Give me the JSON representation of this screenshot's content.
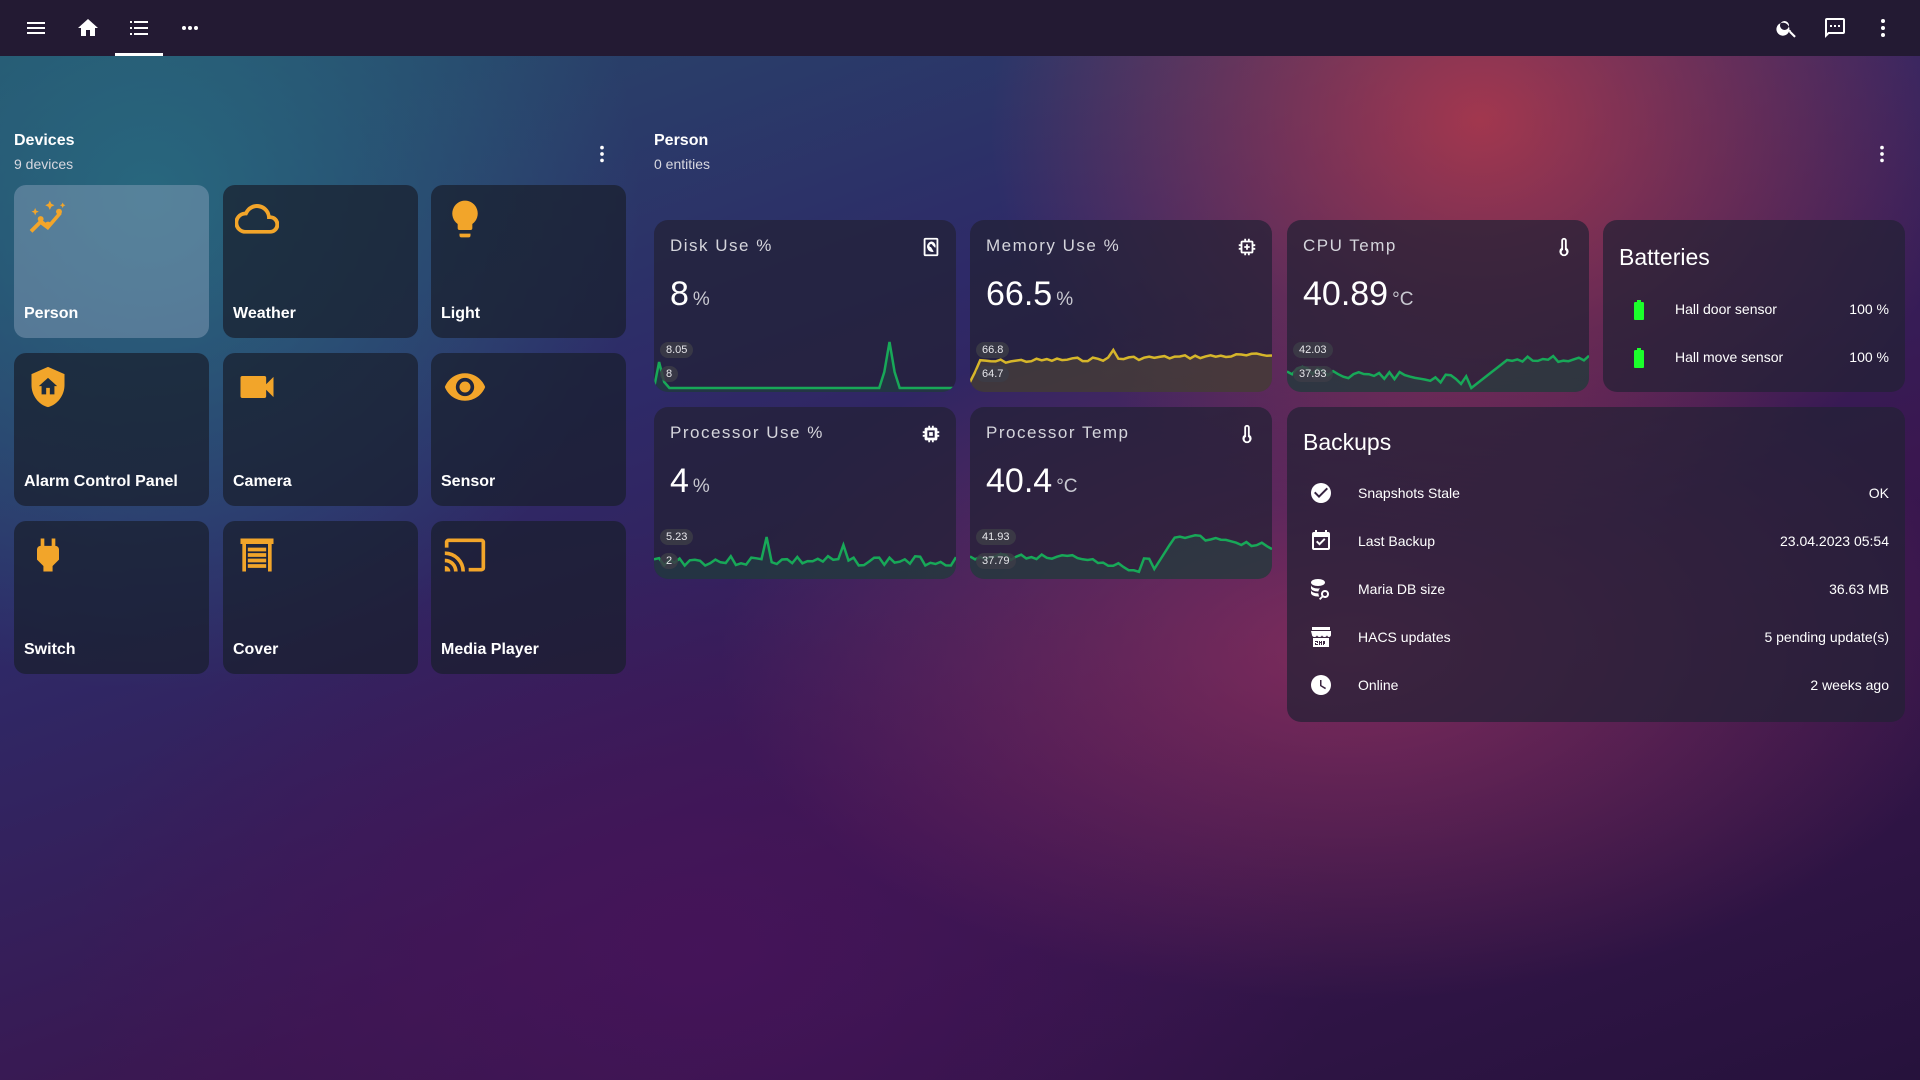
{
  "topbar": {
    "icons": [
      "menu-icon",
      "home-icon",
      "list-icon",
      "more-horizontal-icon",
      "search-icon",
      "assist-chat-icon",
      "more-vertical-icon"
    ]
  },
  "devices": {
    "title": "Devices",
    "subtitle": "9 devices",
    "tiles": [
      {
        "label": "Person",
        "icon": "person-motion-icon"
      },
      {
        "label": "Weather",
        "icon": "cloud-icon"
      },
      {
        "label": "Light",
        "icon": "lightbulb-icon"
      },
      {
        "label": "Alarm Control Panel",
        "icon": "shield-home-icon"
      },
      {
        "label": "Camera",
        "icon": "video-camera-icon"
      },
      {
        "label": "Sensor",
        "icon": "eye-icon"
      },
      {
        "label": "Switch",
        "icon": "power-plug-icon"
      },
      {
        "label": "Cover",
        "icon": "garage-cover-icon"
      },
      {
        "label": "Media Player",
        "icon": "cast-icon"
      }
    ]
  },
  "person": {
    "title": "Person",
    "subtitle": "0 entities"
  },
  "stats": [
    {
      "title": "Disk Use %",
      "value": "8",
      "unit": "%",
      "max": "8.05",
      "min": "8",
      "icon": "harddisk-icon",
      "color": "#18a858"
    },
    {
      "title": "Memory Use %",
      "value": "66.5",
      "unit": "%",
      "max": "66.8",
      "min": "64.7",
      "icon": "memory-chip-icon",
      "color": "#d6b62a"
    },
    {
      "title": "CPU Temp",
      "value": "40.89",
      "unit": "°C",
      "max": "42.03",
      "min": "37.93",
      "icon": "thermometer-icon",
      "color": "#18a858"
    },
    {
      "title": "Processor Use %",
      "value": "4",
      "unit": "%",
      "max": "5.23",
      "min": "2",
      "icon": "cpu-icon",
      "color": "#18a858"
    },
    {
      "title": "Processor Temp",
      "value": "40.4",
      "unit": "°C",
      "max": "41.93",
      "min": "37.79",
      "icon": "thermometer-icon",
      "color": "#18a858"
    }
  ],
  "batteries": {
    "title": "Batteries",
    "rows": [
      {
        "name": "Hall door sensor",
        "value": "100 %",
        "icon": "battery-full-icon"
      },
      {
        "name": "Hall move sensor",
        "value": "100 %",
        "icon": "battery-full-icon"
      }
    ]
  },
  "backups": {
    "title": "Backups",
    "rows": [
      {
        "name": "Snapshots Stale",
        "value": "OK",
        "icon": "check-circle-icon"
      },
      {
        "name": "Last Backup",
        "value": "23.04.2023 05:54",
        "icon": "calendar-check-icon"
      },
      {
        "name": "Maria DB size",
        "value": "36.63 MB",
        "icon": "database-search-icon"
      },
      {
        "name": "HACS updates",
        "value": "5 pending update(s)",
        "icon": "hacs-icon"
      },
      {
        "name": "Online",
        "value": "2 weeks ago",
        "icon": "clock-icon"
      }
    ]
  }
}
